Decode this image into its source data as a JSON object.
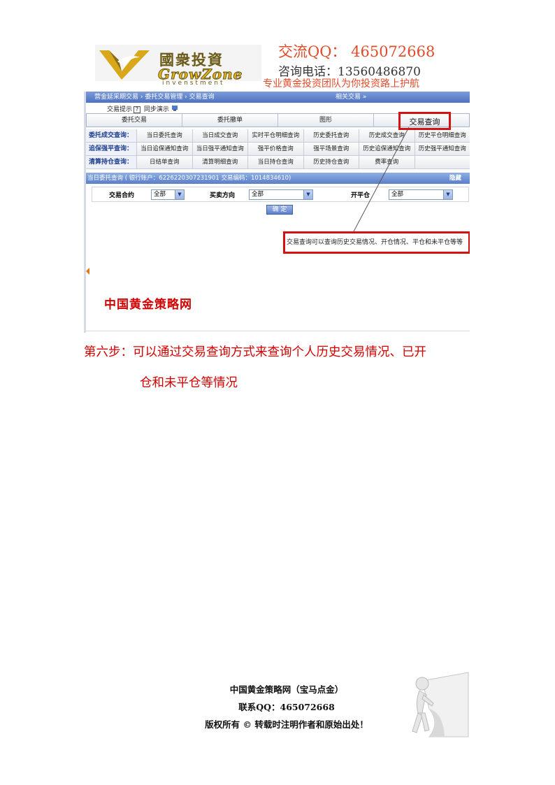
{
  "header": {
    "logo_cn": "國衆投資",
    "logo_en": "GrowZone",
    "logo_sub": "invenstment",
    "qq": "交流QQ： 465072668",
    "phone": "咨询电话：13560486870",
    "slogan": "专业黄金投资团队为你投资路上护航",
    "brand_color": "#e04b2a"
  },
  "screenshot": {
    "breadcrumb": "营金延采期交易 › 委托交易管理 › 交易查询",
    "breadcrumb_right": "相关交易 »",
    "hint": {
      "a": "交易提示",
      "a_box": "?",
      "b": "同步演示"
    },
    "tabs": [
      "委托交易",
      "委托撤单",
      "图形",
      ""
    ],
    "highlight_tab": "交易查询",
    "grid": [
      {
        "head": "委托成交查询：",
        "cells": [
          "当日委托查询",
          "当日成交查询",
          "实时平仓明细查询",
          "历史委托查询",
          "历史成交查询",
          "历史平仓明细查询"
        ]
      },
      {
        "head": "追保强平查询：",
        "cells": [
          "当日追保通知查询",
          "当日强平通知查询",
          "强平价格查询",
          "强平场景查询",
          "历史追保通知查询",
          "历史强平通知查询"
        ]
      },
      {
        "head": "清算持仓查询：",
        "cells": [
          "日结单查询",
          "清算明细查询",
          "当日持仓查询",
          "历史持仓查询",
          "费率查询",
          ""
        ]
      }
    ],
    "bar_text": "当日委托查询 ( 银行账户：6226220307231901 交易编码：1014834610)",
    "bar_hide": "隐藏",
    "form": {
      "contract_label": "交易合约",
      "contract_value": "全部",
      "direction_label": "买卖方向",
      "direction_value": "全部",
      "open_label": "开平仓",
      "open_value": "全部",
      "ok_label": "确 定"
    },
    "callout": "交易查询可以查询历史交易情况、开仓情况、平仓和未平仓等等",
    "watermark": "中国黄金策略网"
  },
  "body": {
    "step_line1": "第六步：可以通过交易查询方式来查询个人历史交易情况、已开",
    "step_line2": "仓和未平仓等情况"
  },
  "footer": {
    "line1": "中国黄金策略网（宝马点金）",
    "line2": "联系QQ：465072668",
    "line3": "版权所有 © 转载时注明作者和原始出处！"
  }
}
